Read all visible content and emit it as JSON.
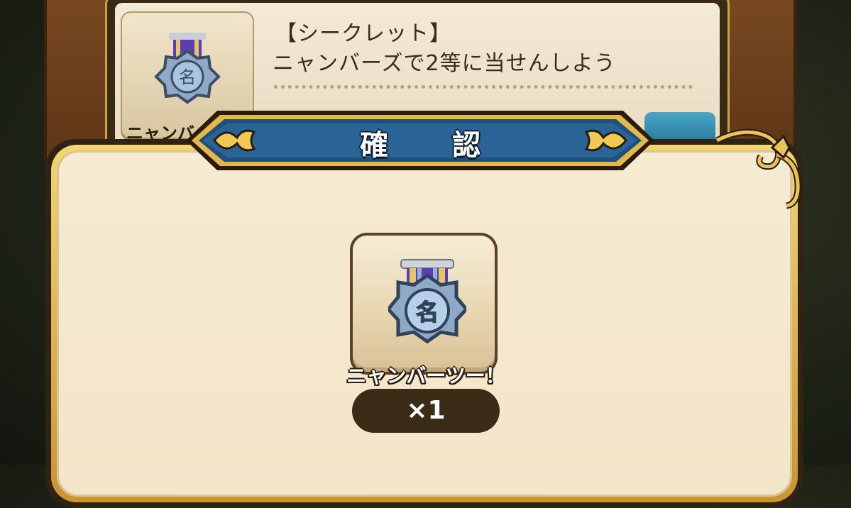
{
  "background_card": {
    "title": "【シークレット】",
    "description": "ニャンバーズで2等に当せんしよう",
    "item_label_cut": "ニャンバ",
    "medal_glyph": "名"
  },
  "dialog": {
    "title": "確 認",
    "item": {
      "icon": "medal-icon",
      "medal_glyph": "名",
      "name": "ニャンバーツー！",
      "quantity": "×1"
    }
  },
  "colors": {
    "banner_blue": "#1f4f7a",
    "gold": "#e0b84a",
    "panel": "#f3e5c8",
    "medal_blue": "#8fb3d6",
    "ribbon_purple": "#5b3fb0"
  }
}
